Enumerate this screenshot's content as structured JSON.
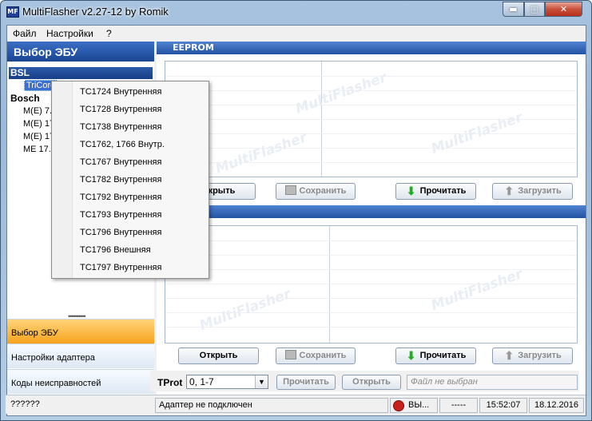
{
  "window": {
    "title": "MultiFlasher v2.27-12 by Romik",
    "min_icon": "minimize-icon",
    "max_icon": "maximize-icon",
    "close_icon": "close-icon",
    "app_icon_text": "MF"
  },
  "menu": {
    "file": "Файл",
    "settings": "Настройки",
    "help": "?"
  },
  "left_panel": {
    "title": "Выбор ЭБУ",
    "groups": [
      {
        "label": "BSL"
      },
      {
        "label": "Bosch"
      }
    ],
    "tree_items": [
      "TriCore",
      "M(E) 7.",
      "M(E) 17",
      "M(E) 17",
      "ME 17."
    ],
    "nav": [
      {
        "label": "Выбор ЭБУ",
        "active": true
      },
      {
        "label": "Настройки адаптера",
        "active": false
      },
      {
        "label": "Коды неисправностей",
        "active": false
      }
    ]
  },
  "eeprom": {
    "title": "EEPROM",
    "buttons": {
      "open": "Открыть",
      "save": "Сохранить",
      "read": "Прочитать",
      "upload": "Загрузить"
    }
  },
  "flash": {
    "buttons": {
      "open": "Открыть",
      "save": "Сохранить",
      "read": "Прочитать",
      "upload": "Загрузить"
    }
  },
  "watermark": "MultiFlasher",
  "tprot": {
    "label": "TProt",
    "selected": "0, 1-7",
    "read": "Прочитать",
    "open": "Открыть",
    "file_placeholder": "Файл не выбран"
  },
  "status": {
    "left": "??????",
    "adapter": "Адаптер не подключен",
    "indicator": "ВЫ...",
    "dashes": "-----",
    "time": "15:52:07",
    "date": "18.12.2016"
  },
  "popup_menu": {
    "items": [
      "TC1724 Внутренняя",
      "TC1728 Внутренняя",
      "TC1738 Внутренняя",
      "TC1762, 1766 Внутр.",
      "TC1767 Внутренняя",
      "TC1782 Внутренняя",
      "TC1792 Внутренняя",
      "TC1793 Внутренняя",
      "TC1796 Внутренняя",
      "TC1796 Внешняя",
      "TC1797 Внутренняя"
    ]
  },
  "colors": {
    "accent": "#1b4592",
    "active_nav": "#f7a21d",
    "read_arrow": "#1fae1f",
    "status_red": "#c8201c"
  }
}
